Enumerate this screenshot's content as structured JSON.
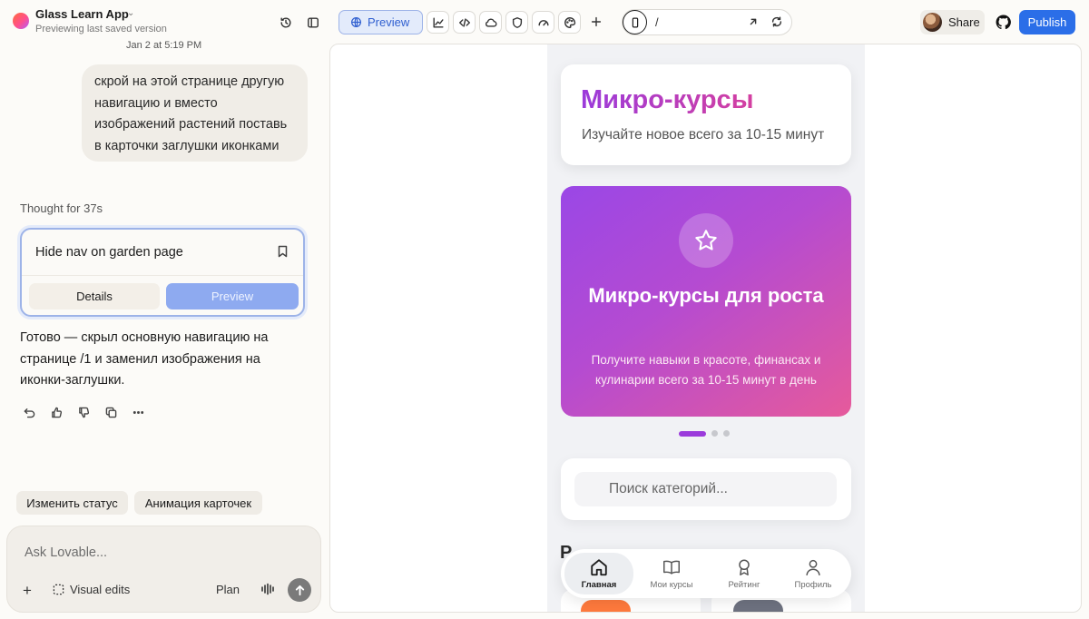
{
  "topbar": {
    "app_title": "Glass Learn App",
    "subtitle": "Previewing last saved version",
    "preview_label": "Preview",
    "url_path": "/",
    "share_label": "Share",
    "publish_label": "Publish"
  },
  "chat": {
    "timestamp": "Jan 2 at 5:19 PM",
    "user_message": "скрой на этой странице другую навигацию и вместо изображений растений поставь в карточки заглушки иконками",
    "thought": "Thought for 37s",
    "task": {
      "title": "Hide nav on garden page",
      "details_label": "Details",
      "preview_label": "Preview"
    },
    "reply": "Готово — скрыл основную навигацию на странице /1 и заменил изображения на иконки-заглушки.",
    "suggestions": [
      "Изменить статус",
      "Анимация карточек"
    ],
    "composer": {
      "placeholder": "Ask Lovable...",
      "visual_edits_label": "Visual edits",
      "plan_label": "Plan"
    }
  },
  "preview": {
    "header": {
      "title": "Микро-курсы",
      "subtitle": "Изучайте новое всего за 10-15 минут"
    },
    "hero": {
      "title": "Микро-курсы для роста",
      "description": "Получите навыки в красоте, финансах и кулинарии всего за 10-15 минут в день",
      "icon": "star-icon"
    },
    "carousel": {
      "total": 3,
      "active": 1
    },
    "search_placeholder": "Поиск категорий...",
    "section_peek": "Р",
    "bottom_nav": [
      {
        "label": "Главная",
        "icon": "home-icon",
        "active": true
      },
      {
        "label": "Мои курсы",
        "icon": "book-icon",
        "active": false
      },
      {
        "label": "Рейтинг",
        "icon": "award-icon",
        "active": false
      },
      {
        "label": "Профиль",
        "icon": "user-icon",
        "active": false
      }
    ]
  },
  "colors": {
    "accent_blue": "#2b6ee8",
    "gradient_start": "#9a47e6",
    "gradient_end": "#e65a9b",
    "title_purple": "#9b3bdb"
  }
}
